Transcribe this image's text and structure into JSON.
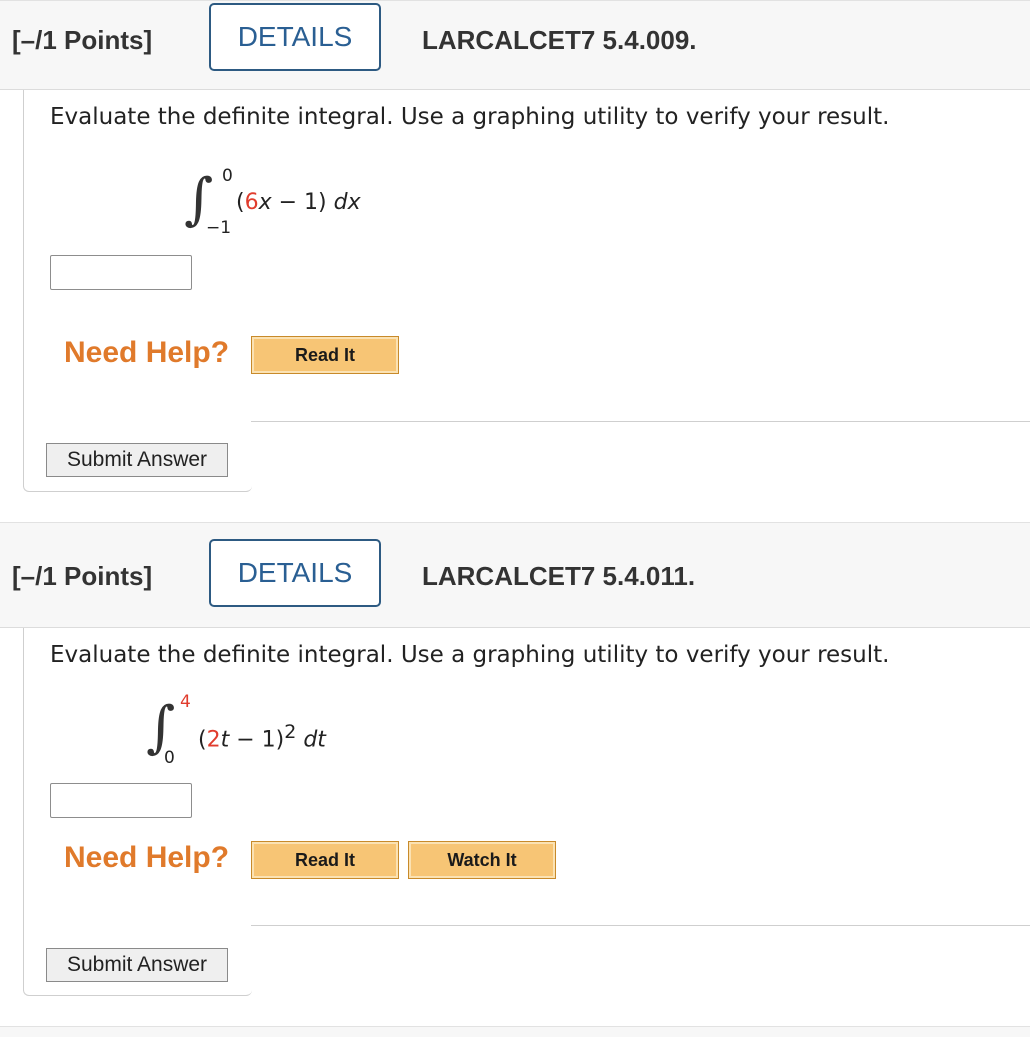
{
  "questions": [
    {
      "points": "[–/1 Points]",
      "details_label": "DETAILS",
      "code": "LARCALCET7 5.4.009.",
      "prompt": "Evaluate the definite integral. Use a graphing utility to verify your result.",
      "integral": {
        "upper": "0",
        "lower": "−1",
        "open_paren": "(",
        "coef": "6",
        "var": "x",
        "rest": " − 1)",
        "differential": "dx",
        "exponent": ""
      },
      "answer_value": "",
      "need_help": "Need Help?",
      "help_buttons": [
        "Read It"
      ],
      "submit_label": "Submit Answer"
    },
    {
      "points": "[–/1 Points]",
      "details_label": "DETAILS",
      "code": "LARCALCET7 5.4.011.",
      "prompt": "Evaluate the definite integral. Use a graphing utility to verify your result.",
      "integral": {
        "upper": "4",
        "lower": "0",
        "open_paren": "(",
        "coef": "2",
        "var": "t",
        "rest": " − 1)",
        "exponent": "2",
        "differential": "dt"
      },
      "answer_value": "",
      "need_help": "Need Help?",
      "help_buttons": [
        "Read It",
        "Watch It"
      ],
      "submit_label": "Submit Answer"
    }
  ],
  "colors": {
    "details_border": "#2d5a82",
    "details_text": "#2a5f93",
    "need_help": "#e07a2b",
    "help_button": "#f7c575",
    "highlight_red": "#e03c2d"
  }
}
